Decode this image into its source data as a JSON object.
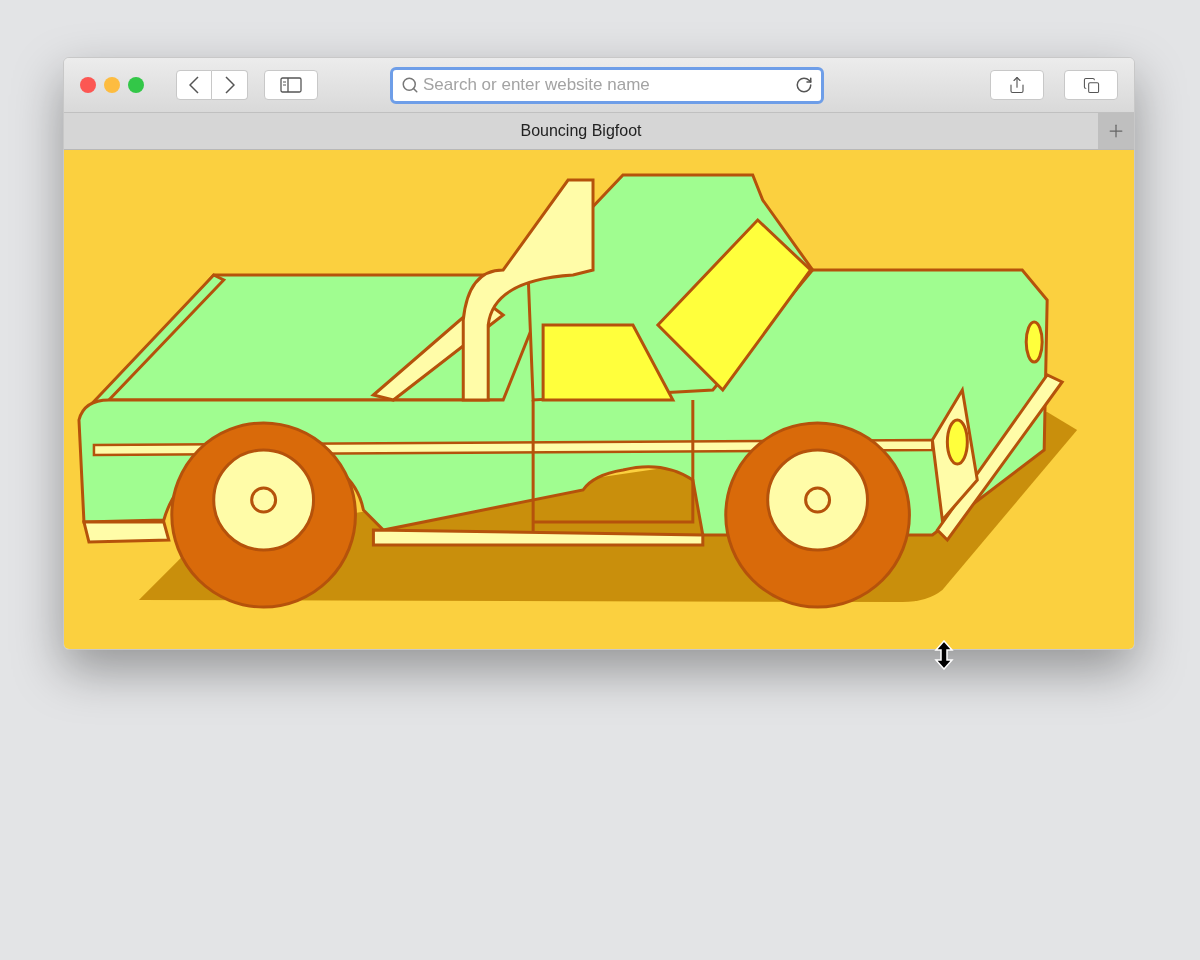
{
  "window": {
    "tab_title": "Bouncing Bigfoot"
  },
  "address_bar": {
    "placeholder": "Search or enter website name",
    "focused": true
  }
}
